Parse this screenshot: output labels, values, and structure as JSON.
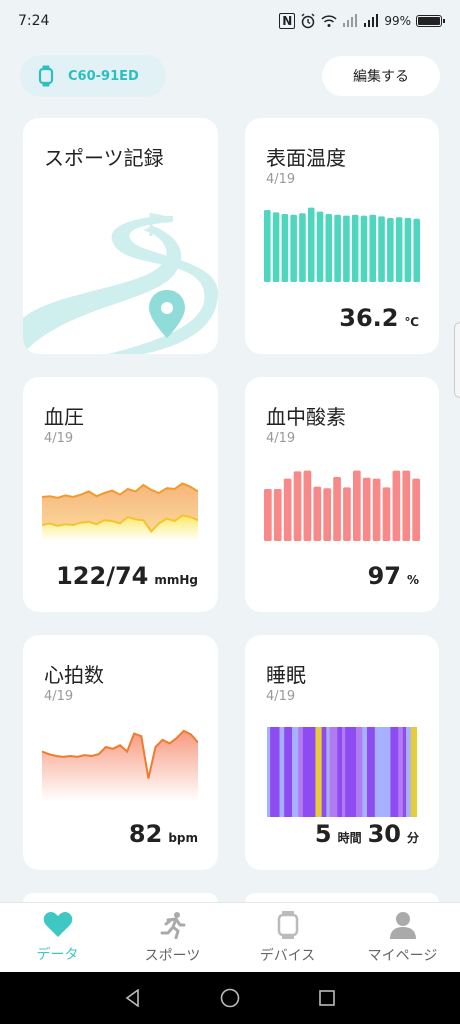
{
  "status_bar": {
    "time": "7:24",
    "battery": "99%"
  },
  "device": {
    "name": "C60-91ED"
  },
  "header": {
    "edit_label": "編集する"
  },
  "cards": {
    "sports": {
      "title": "スポーツ記録"
    },
    "surface_temp": {
      "title": "表面温度",
      "date": "4/19",
      "value": "36.2",
      "unit": "℃"
    },
    "blood_pressure": {
      "title": "血圧",
      "date": "4/19",
      "value": "122/74",
      "unit": "mmHg"
    },
    "blood_oxygen": {
      "title": "血中酸素",
      "date": "4/19",
      "value": "97",
      "unit": "%"
    },
    "heart_rate": {
      "title": "心拍数",
      "date": "4/19",
      "value": "82",
      "unit": "bpm"
    },
    "sleep": {
      "title": "睡眠",
      "date": "4/19",
      "hours": "5",
      "hours_unit": "時間",
      "minutes": "30",
      "minutes_unit": "分"
    }
  },
  "nav": [
    {
      "label": "データ",
      "icon": "heart-icon",
      "active": true
    },
    {
      "label": "スポーツ",
      "icon": "runner-icon",
      "active": false
    },
    {
      "label": "デバイス",
      "icon": "watch-icon",
      "active": false
    },
    {
      "label": "マイページ",
      "icon": "person-icon",
      "active": false
    }
  ],
  "colors": {
    "accent": "#3fc7c4",
    "temp_bars": "#4fd6bf",
    "oxygen_bars": "#f98888",
    "heart_line": "#f07b2c",
    "bp_line": "#f39a2c",
    "bp_fill_bottom": "#fbe96b"
  },
  "chart_data": [
    {
      "type": "bar",
      "name": "surface-temp-chart",
      "values": [
        0.9,
        0.87,
        0.85,
        0.84,
        0.86,
        0.93,
        0.88,
        0.85,
        0.84,
        0.83,
        0.84,
        0.83,
        0.84,
        0.82,
        0.8,
        0.81,
        0.8,
        0.79
      ],
      "ylim": [
        0,
        1
      ]
    },
    {
      "type": "bar",
      "name": "blood-oxygen-chart",
      "values": [
        0.65,
        0.65,
        0.78,
        0.87,
        0.88,
        0.68,
        0.66,
        0.8,
        0.67,
        0.88,
        0.79,
        0.78,
        0.67,
        0.88,
        0.88,
        0.78
      ],
      "ylim": [
        0,
        1
      ]
    },
    {
      "type": "area",
      "name": "blood-pressure-chart",
      "series": [
        {
          "values": [
            0.55,
            0.56,
            0.54,
            0.57,
            0.55,
            0.58,
            0.62,
            0.56,
            0.6,
            0.63,
            0.58,
            0.65,
            0.62,
            0.7,
            0.64,
            0.6,
            0.66,
            0.65,
            0.72,
            0.68,
            0.62
          ]
        },
        {
          "values": [
            0.2,
            0.22,
            0.19,
            0.21,
            0.2,
            0.23,
            0.24,
            0.21,
            0.26,
            0.25,
            0.22,
            0.3,
            0.27,
            0.26,
            0.12,
            0.22,
            0.28,
            0.25,
            0.32,
            0.3,
            0.26
          ]
        }
      ],
      "ylim": [
        0,
        1
      ]
    },
    {
      "type": "area",
      "name": "heart-rate-chart",
      "series": [
        {
          "values": [
            0.55,
            0.52,
            0.5,
            0.49,
            0.5,
            0.49,
            0.51,
            0.5,
            0.52,
            0.6,
            0.58,
            0.62,
            0.55,
            0.75,
            0.72,
            0.25,
            0.6,
            0.68,
            0.64,
            0.7,
            0.78,
            0.74,
            0.65
          ]
        }
      ],
      "ylim": [
        0,
        1
      ]
    },
    {
      "type": "bar",
      "name": "sleep-chart",
      "segments": [
        {
          "w": 2,
          "stage": "light"
        },
        {
          "w": 6,
          "stage": "deep"
        },
        {
          "w": 3,
          "stage": "light"
        },
        {
          "w": 5,
          "stage": "deep"
        },
        {
          "w": 4,
          "stage": "light"
        },
        {
          "w": 3,
          "stage": "rem"
        },
        {
          "w": 8,
          "stage": "deep"
        },
        {
          "w": 4,
          "stage": "awake"
        },
        {
          "w": 3,
          "stage": "deep"
        },
        {
          "w": 2,
          "stage": "light"
        },
        {
          "w": 5,
          "stage": "rem"
        },
        {
          "w": 3,
          "stage": "deep"
        },
        {
          "w": 2,
          "stage": "rem"
        },
        {
          "w": 7,
          "stage": "deep"
        },
        {
          "w": 4,
          "stage": "rem"
        },
        {
          "w": 3,
          "stage": "light"
        },
        {
          "w": 5,
          "stage": "deep"
        },
        {
          "w": 10,
          "stage": "light"
        },
        {
          "w": 5,
          "stage": "deep"
        },
        {
          "w": 3,
          "stage": "rem"
        },
        {
          "w": 2,
          "stage": "deep"
        },
        {
          "w": 3,
          "stage": "light"
        },
        {
          "w": 4,
          "stage": "awake"
        }
      ],
      "stage_colors": {
        "deep": "#8e4bf2",
        "light": "#a6b2ff",
        "rem": "#b07cf0",
        "awake": "#e6cc3a"
      }
    }
  ]
}
